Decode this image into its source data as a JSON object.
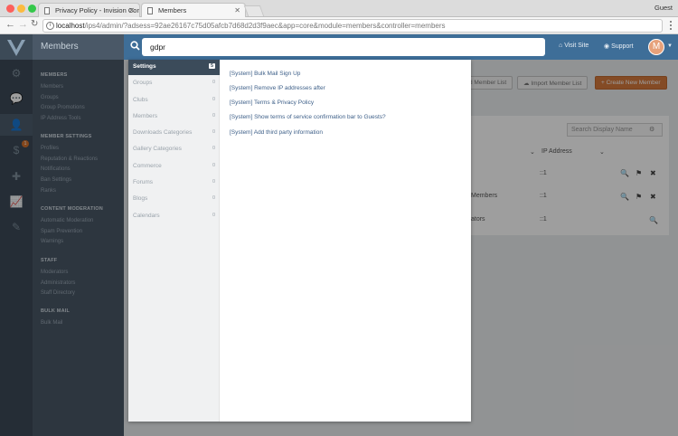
{
  "browser": {
    "tabs": [
      {
        "title": "Privacy Policy - Invision Comm"
      },
      {
        "title": "Members"
      }
    ],
    "profile": "Guest",
    "url_host": "localhost",
    "url_path": "/ips4/admin/?adsess=92ae26167c75d05afcb7d68d2d3f9aec&app=core&module=members&controller=members"
  },
  "sidebar": {
    "title": "Members",
    "sections": [
      {
        "heading": "MEMBERS",
        "items": [
          "Members",
          "Groups",
          "Group Promotions",
          "IP Address Tools"
        ]
      },
      {
        "heading": "MEMBER SETTINGS",
        "items": [
          "Profiles",
          "Reputation & Reactions",
          "Notifications",
          "Ban Settings",
          "Ranks"
        ]
      },
      {
        "heading": "CONTENT MODERATION",
        "items": [
          "Automatic Moderation",
          "Spam Prevention",
          "Warnings"
        ]
      },
      {
        "heading": "STAFF",
        "items": [
          "Moderators",
          "Administrators",
          "Staff Directory"
        ]
      },
      {
        "heading": "BULK MAIL",
        "items": [
          "Bulk Mail"
        ]
      }
    ],
    "rail_badge": "1"
  },
  "header": {
    "search_value": "gdpr",
    "visit_site": "Visit Site",
    "support": "Support",
    "avatar_letter": "M"
  },
  "background": {
    "buttons": [
      "d Member List",
      "Import Member List",
      "Create New Member"
    ],
    "search_placeholder": "Search Display Name",
    "ip_header": "IP Address",
    "row_ip": "::1",
    "row_group_partial": "Members",
    "row_admin_partial": "ators"
  },
  "popup": {
    "categories": [
      {
        "label": "Settings",
        "count": "5"
      },
      {
        "label": "Groups",
        "count": "0"
      },
      {
        "label": "Clubs",
        "count": "0"
      },
      {
        "label": "Members",
        "count": "0"
      },
      {
        "label": "Downloads Categories",
        "count": "0"
      },
      {
        "label": "Gallery Categories",
        "count": "0"
      },
      {
        "label": "Commerce",
        "count": "0"
      },
      {
        "label": "Forums",
        "count": "0"
      },
      {
        "label": "Blogs",
        "count": "0"
      },
      {
        "label": "Calendars",
        "count": "0"
      }
    ],
    "results": [
      "[System] Bulk Mail Sign Up",
      "[System] Remove IP addresses after",
      "[System] Terms & Privacy Policy",
      "[System] Show terms of service confirmation bar to Guests?",
      "[System] Add third party information"
    ]
  },
  "colors": {
    "header_blue": "#3e6e98",
    "sidebar": "#4a5867",
    "rail": "#3c4a57",
    "active_category": "#3b4b5a",
    "link": "#3d5f88",
    "accent_orange": "#d57a3d"
  }
}
